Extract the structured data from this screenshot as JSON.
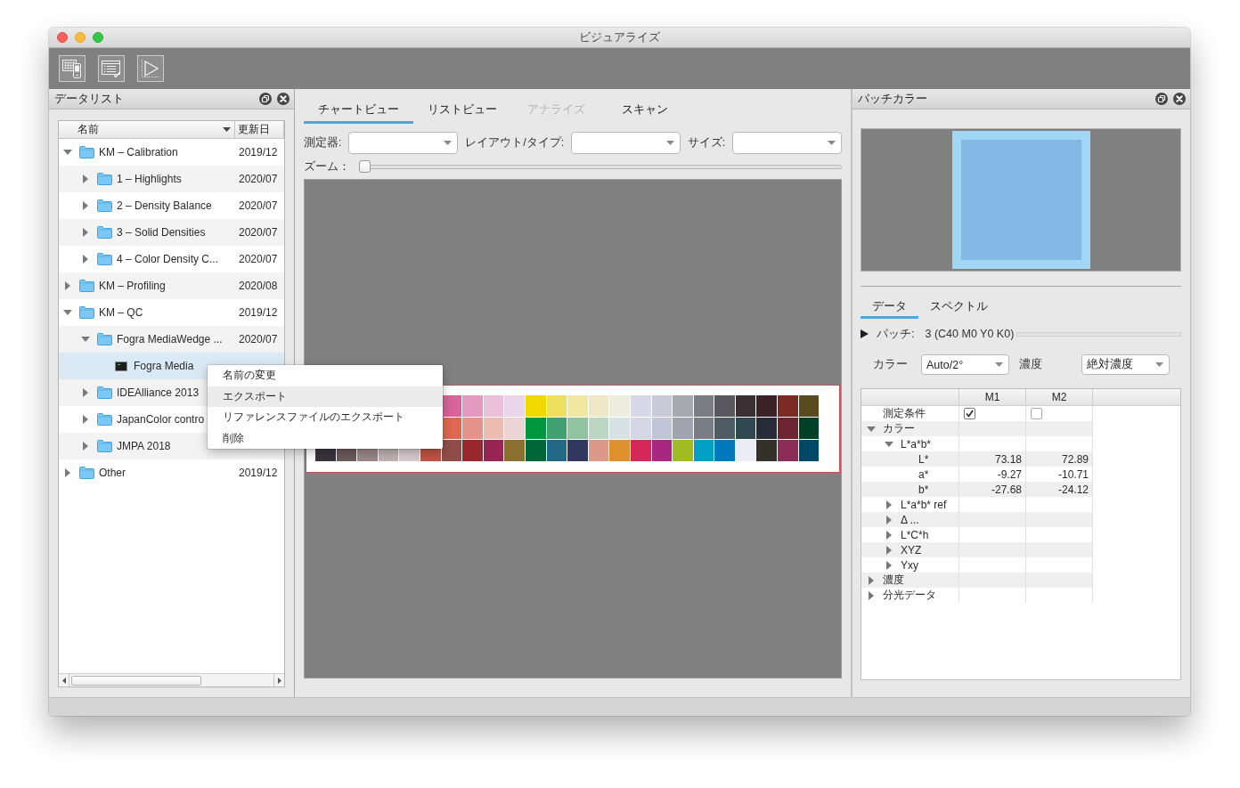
{
  "window": {
    "title": "ビジュアライズ"
  },
  "data_list": {
    "title": "データリスト",
    "columns": [
      "名前",
      "更新日"
    ],
    "rows": [
      {
        "name": "KM – Calibration",
        "date": "2019/12",
        "kind": "folder",
        "expanded": true,
        "selected": false,
        "children": [
          {
            "name": "1 – Highlights",
            "date": "2020/07",
            "kind": "folder",
            "expanded": false,
            "selected": false
          },
          {
            "name": "2 – Density Balance",
            "date": "2020/07",
            "kind": "folder",
            "expanded": false,
            "selected": false
          },
          {
            "name": "3 – Solid Densities",
            "date": "2020/07",
            "kind": "folder",
            "expanded": false,
            "selected": false
          },
          {
            "name": "4 – Color Density C...",
            "date": "2020/07",
            "kind": "folder",
            "expanded": false,
            "selected": false
          }
        ]
      },
      {
        "name": "KM – Profiling",
        "date": "2020/08",
        "kind": "folder",
        "expanded": false,
        "selected": false
      },
      {
        "name": "KM – QC",
        "date": "2019/12",
        "kind": "folder",
        "expanded": true,
        "selected": false,
        "children": [
          {
            "name": "Fogra MediaWedge ...",
            "date": "2020/07",
            "kind": "folder",
            "expanded": true,
            "selected": false,
            "children": [
              {
                "name": "Fogra Media",
                "kind": "file",
                "selected": true
              }
            ]
          },
          {
            "name": "IDEAlliance 2013",
            "kind": "folder",
            "expanded": false,
            "selected": false
          },
          {
            "name": "JapanColor contro",
            "kind": "folder",
            "expanded": false,
            "selected": false
          },
          {
            "name": "JMPA 2018",
            "kind": "folder",
            "expanded": false,
            "selected": false
          }
        ]
      },
      {
        "name": "Other",
        "date": "2019/12",
        "kind": "folder",
        "expanded": false,
        "selected": false
      }
    ]
  },
  "context_menu": {
    "items": [
      {
        "label": "名前の変更",
        "selected": false
      },
      {
        "label": "エクスポート",
        "selected": true
      },
      {
        "label": "リファレンスファイルのエクスポート",
        "selected": false
      },
      {
        "label": "削除",
        "selected": false
      }
    ]
  },
  "chart_view": {
    "tabs": [
      {
        "label": "チャートビュー",
        "selected": true,
        "disabled": false
      },
      {
        "label": "リストビュー",
        "selected": false,
        "disabled": false
      },
      {
        "label": "アナライズ",
        "selected": false,
        "disabled": true
      },
      {
        "label": "スキャン",
        "selected": false,
        "disabled": false
      }
    ],
    "fields": [
      {
        "label": "測定器:"
      },
      {
        "label": "レイアウト/タイプ:"
      },
      {
        "label": "サイズ:"
      }
    ],
    "zoom": {
      "label": "ズーム：",
      "level": 0
    },
    "patch_chart": {
      "rows": [
        [
          null,
          null,
          null,
          null,
          null,
          null,
          {
            "color": "#d8649a"
          },
          {
            "color": "#e39ac0"
          },
          {
            "color": "#ecc0da"
          },
          {
            "color": "#ead5ea"
          },
          {
            "color": "#f0d800"
          },
          {
            "color": "#ede060"
          },
          {
            "color": "#f0e8a0"
          },
          {
            "color": "#eee8c8"
          },
          {
            "color": "#ececdf"
          },
          {
            "color": "#d8d8e8"
          },
          {
            "color": "#c8cad8"
          },
          {
            "color": "#a8a8b0"
          },
          {
            "color": "#7c7c84"
          },
          {
            "color": "#58585e"
          },
          {
            "color": "#3a3034"
          },
          {
            "color": "#3a2226"
          },
          {
            "color": "#7c2a24"
          },
          {
            "color": "#5a4a20"
          }
        ],
        [
          null,
          null,
          null,
          null,
          null,
          null,
          {
            "color": "#e06850"
          },
          {
            "color": "#e49488"
          },
          {
            "color": "#ecbcb0"
          },
          {
            "color": "#ecd4d4"
          },
          {
            "color": "#00963e"
          },
          {
            "color": "#40a070"
          },
          {
            "color": "#90c4a0"
          },
          {
            "color": "#bcd8c4"
          },
          {
            "color": "#d8e2e4"
          },
          {
            "color": "#d4d6e6"
          },
          {
            "color": "#c0c6d8"
          },
          {
            "color": "#a0a4ae"
          },
          {
            "color": "#787c84"
          },
          {
            "color": "#505c64"
          },
          {
            "color": "#304850"
          },
          {
            "color": "#262c38"
          },
          {
            "color": "#6c2430"
          },
          {
            "color": "#004028"
          }
        ],
        [
          {
            "color": "#38343c"
          },
          {
            "color": "#6c5a5c"
          },
          {
            "color": "#9c8888"
          },
          {
            "color": "#c0b0b4"
          },
          {
            "color": "#d8ccd0"
          },
          {
            "color": "#c05444"
          },
          {
            "color": "#904c48"
          },
          {
            "color": "#98282c"
          },
          {
            "color": "#982454"
          },
          {
            "color": "#8c7030"
          },
          {
            "color": "#006838"
          },
          {
            "color": "#246888"
          },
          {
            "color": "#303860"
          },
          {
            "color": "#dc9888"
          },
          {
            "color": "#e0902c"
          },
          {
            "color": "#d42858"
          },
          {
            "color": "#a82880"
          },
          {
            "color": "#a0bc20"
          },
          {
            "color": "#00a0c4"
          },
          {
            "color": "#0078c0"
          },
          {
            "color": "#ececf6"
          },
          {
            "color": "#34302a"
          },
          {
            "color": "#8c2c58"
          },
          {
            "color": "#004868"
          }
        ]
      ]
    }
  },
  "patch_color": {
    "title": "パッチカラー",
    "tabs": [
      {
        "label": "データ",
        "selected": true
      },
      {
        "label": "スペクトル",
        "selected": false
      }
    ],
    "patch": {
      "label": "パッチ:",
      "value": "3 (C40 M0 Y0 K0)"
    },
    "color_select": {
      "label": "カラー",
      "value": "Auto/2°"
    },
    "density_select": {
      "label": "濃度",
      "value": "絶対濃度"
    },
    "table": {
      "columns": [
        "M1",
        "M2"
      ],
      "rows": [
        {
          "label": "測定条件",
          "kind": "check",
          "cells": [
            {
              "checked": true
            },
            {
              "checked": false
            }
          ]
        },
        {
          "label": "カラー",
          "kind": "group",
          "expanded": true,
          "children": [
            {
              "label": "L*a*b*",
              "kind": "group",
              "expanded": true,
              "children": [
                {
                  "label": "L*",
                  "kind": "value",
                  "cells": [
                    "73.18",
                    "72.89"
                  ]
                },
                {
                  "label": "a*",
                  "kind": "value",
                  "cells": [
                    "-9.27",
                    "-10.71"
                  ]
                },
                {
                  "label": "b*",
                  "kind": "value",
                  "cells": [
                    "-27.68",
                    "-24.12"
                  ]
                }
              ]
            },
            {
              "label": "L*a*b* ref",
              "kind": "group",
              "expanded": false
            },
            {
              "label": "Δ ...",
              "kind": "group",
              "expanded": false
            },
            {
              "label": "L*C*h",
              "kind": "group",
              "expanded": false
            },
            {
              "label": "XYZ",
              "kind": "group",
              "expanded": false
            },
            {
              "label": "Yxy",
              "kind": "group",
              "expanded": false
            }
          ]
        },
        {
          "label": "濃度",
          "kind": "group",
          "expanded": false
        },
        {
          "label": "分光データ",
          "kind": "group",
          "expanded": false
        }
      ]
    }
  }
}
